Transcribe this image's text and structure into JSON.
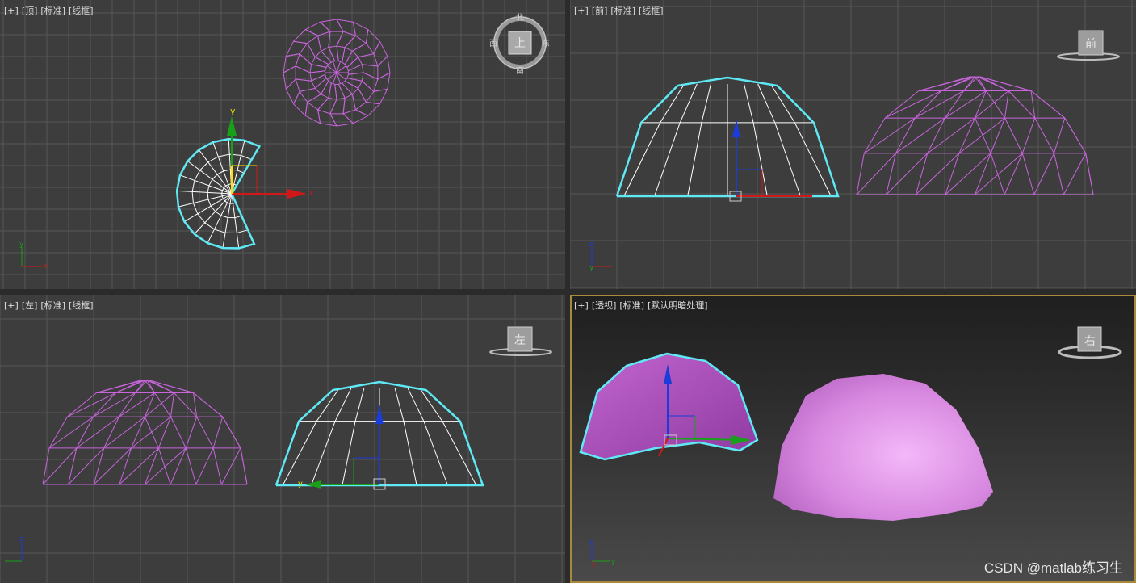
{
  "viewports": [
    {
      "id": "top",
      "labels": [
        "[+]",
        "[顶]",
        "[标准]",
        "[线框]"
      ],
      "cube_label": "上",
      "compass": {
        "north": "北",
        "south": "南",
        "east": "东",
        "west": "西"
      }
    },
    {
      "id": "front",
      "labels": [
        "[+]",
        "[前]",
        "[标准]",
        "[线框]"
      ],
      "cube_label": "前"
    },
    {
      "id": "left",
      "labels": [
        "[+]",
        "[左]",
        "[标准]",
        "[线框]"
      ],
      "cube_label": "左"
    },
    {
      "id": "perspective",
      "labels": [
        "[+]",
        "[透视]",
        "[标准]",
        "[默认明暗处理]"
      ],
      "cube_label": "右"
    }
  ],
  "axes": {
    "x": "x",
    "y": "y",
    "z": "z"
  },
  "colors": {
    "selection": "#5fe9f5",
    "wire": "#ffffff",
    "sphere": "#c864dc",
    "x_axis": "#d01818",
    "y_axis": "#18a018",
    "z_axis": "#1a3cd8",
    "active_border": "#a88a3a",
    "shaded_a": "#a84ab6",
    "shaded_b": "#e9a6f0"
  },
  "watermark": "CSDN @matlab练习生"
}
